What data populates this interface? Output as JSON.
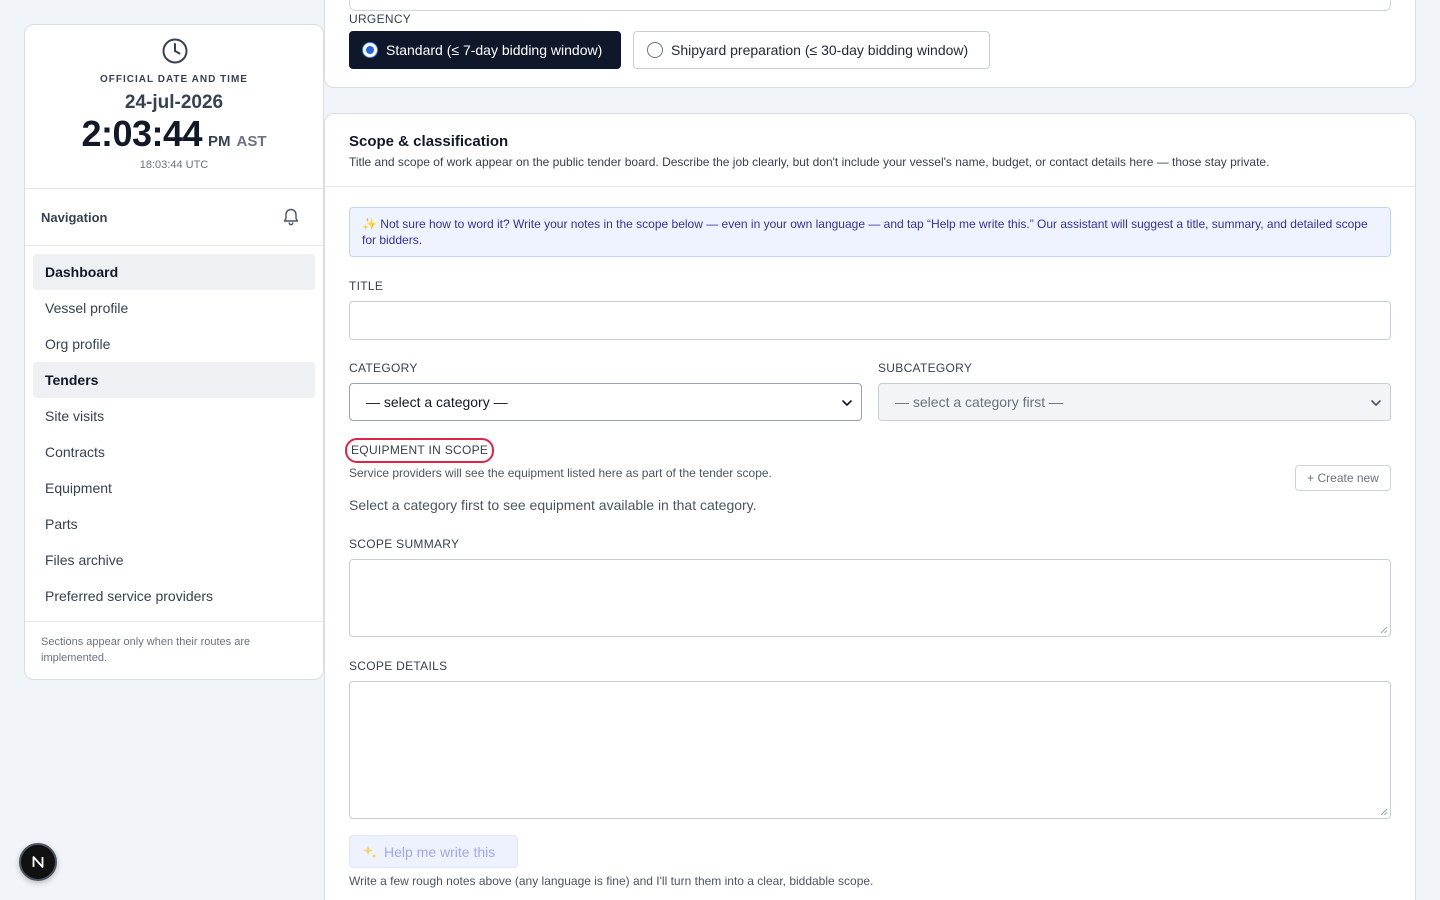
{
  "clock": {
    "label": "OFFICIAL DATE AND TIME",
    "date": "24-jul-2026",
    "time": "2:03:44",
    "ampm": "PM",
    "timezone": "AST",
    "utc": "18:03:44 UTC"
  },
  "sidebar": {
    "title": "Navigation",
    "items": [
      {
        "label": "Dashboard",
        "active": true
      },
      {
        "label": "Vessel profile",
        "active": false
      },
      {
        "label": "Org profile",
        "active": false
      },
      {
        "label": "Tenders",
        "active": true
      },
      {
        "label": "Site visits",
        "active": false
      },
      {
        "label": "Contracts",
        "active": false
      },
      {
        "label": "Equipment",
        "active": false
      },
      {
        "label": "Parts",
        "active": false
      },
      {
        "label": "Files archive",
        "active": false
      },
      {
        "label": "Preferred service providers",
        "active": false
      }
    ],
    "note": "Sections appear only when their routes are implemented."
  },
  "urgency": {
    "label": "URGENCY",
    "options": [
      {
        "label": "Standard (≤ 7-day bidding window)",
        "selected": true
      },
      {
        "label": "Shipyard preparation (≤ 30-day bidding window)",
        "selected": false
      }
    ]
  },
  "scope": {
    "title": "Scope & classification",
    "description": "Title and scope of work appear on the public tender board. Describe the job clearly, but don't include your vessel's name, budget, or contact details here — those stay private.",
    "tip": "✨ Not sure how to word it? Write your notes in the scope below — even in your own language — and tap “Help me write this.” Our assistant will suggest a title, summary, and detailed scope for bidders.",
    "title_label": "TITLE",
    "title_value": "",
    "category_label": "CATEGORY",
    "category_value": "— select a category —",
    "subcategory_label": "SUBCATEGORY",
    "subcategory_value": "— select a category first —",
    "equipment_label": "EQUIPMENT IN SCOPE",
    "equipment_hint": "Service providers will see the equipment listed here as part of the tender scope.",
    "create_new": "+ Create new",
    "equipment_empty": "Select a category first to see equipment available in that category.",
    "summary_label": "SCOPE SUMMARY",
    "summary_value": "",
    "details_label": "SCOPE DETAILS",
    "details_value": "",
    "help_button": "Help me write this",
    "help_icon": "sparkles-icon",
    "help_hint": "Write a few rough notes above (any language is fine) and I'll turn them into a clear, biddable scope."
  },
  "colors": {
    "selected_option_bg": "#0f172a",
    "highlight_ring": "#dc2547",
    "tip_bg": "#eff3ff",
    "tip_text": "#3730a3"
  }
}
